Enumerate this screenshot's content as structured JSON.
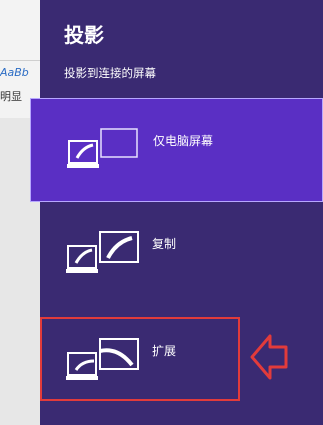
{
  "background_app": {
    "style_sample": "AaBb",
    "style_name": "明显"
  },
  "pane": {
    "title": "投影",
    "subtitle": "投影到连接的屏幕",
    "options": [
      {
        "label": "仅电脑屏幕",
        "icon": "pc-screen-only-icon",
        "selected": true
      },
      {
        "label": "复制",
        "icon": "duplicate-icon",
        "selected": false
      },
      {
        "label": "扩展",
        "icon": "extend-icon",
        "selected": false
      }
    ]
  },
  "colors": {
    "pane_background": "#3a2a72",
    "selected_background": "#5a2fc4",
    "highlight_annotation": "#e23b3b"
  }
}
